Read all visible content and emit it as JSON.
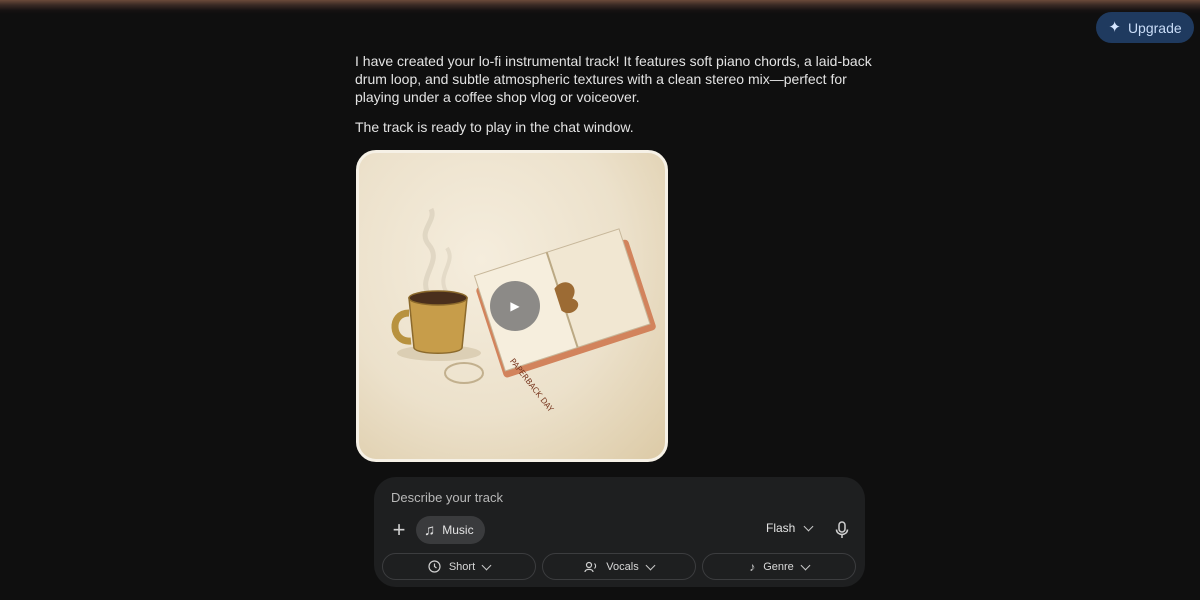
{
  "header": {
    "upgrade_label": "Upgrade"
  },
  "message": {
    "paragraphs": [
      "I have created your lo-fi instrumental track! It features soft piano chords, a laid-back drum loop, and subtle atmospheric textures with a clean stereo mix—perfect for playing under a coffee shop vlog or voiceover.",
      "The track is ready to play in the chat window."
    ]
  },
  "card": {
    "book_spine_text": "PAPERBACK DAY"
  },
  "composer": {
    "placeholder": "Describe your track",
    "mode_chip_label": "Music",
    "model_label": "Flash",
    "options": [
      {
        "label": "Short",
        "icon": "clock-icon"
      },
      {
        "label": "Vocals",
        "icon": "vocals-icon"
      },
      {
        "label": "Genre",
        "icon": "music-note-icon"
      }
    ]
  },
  "colors": {
    "background": "#0f0f0f",
    "upgrade_bg": "#1f3a5f",
    "composer_bg": "#1e1f20"
  }
}
